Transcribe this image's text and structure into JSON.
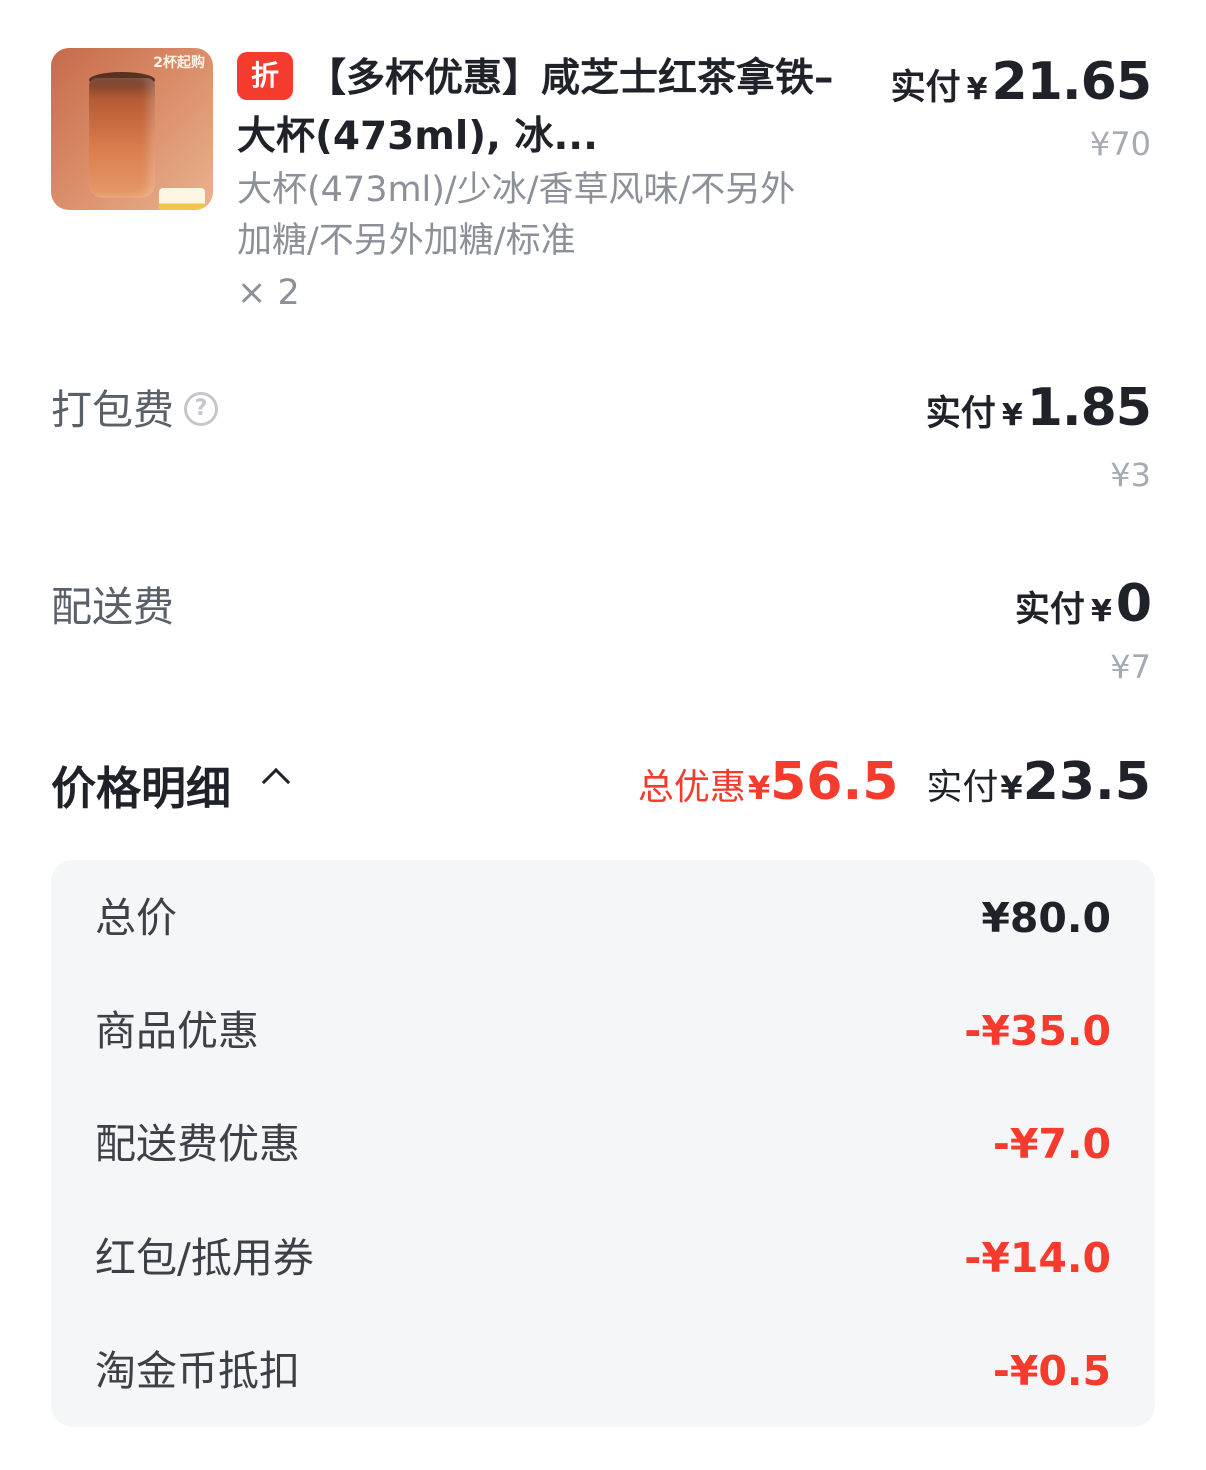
{
  "product": {
    "thumb_badge": "2杯起购",
    "discount_tag": "折",
    "title": "【多杯优惠】咸芝士红茶拿铁–大杯(473ml), 冰...",
    "specs": "大杯(473ml)/少冰/香草风味/不另外加糖/不另外加糖/标准",
    "quantity": "× 2",
    "pay_label": "实付",
    "pay_currency": "¥",
    "pay_amount": "21.65",
    "original_price": "¥70"
  },
  "packing_fee": {
    "label": "打包费",
    "help_icon": "?",
    "pay_label": "实付",
    "pay_currency": "¥",
    "pay_amount": "1.85",
    "original_price": "¥3"
  },
  "delivery_fee": {
    "label": "配送费",
    "pay_label": "实付",
    "pay_currency": "¥",
    "pay_amount": "0",
    "original_price": "¥7"
  },
  "price_detail": {
    "title": "价格明细",
    "total_discount_label": "总优惠",
    "total_discount_currency": "¥",
    "total_discount_amount": "56.5",
    "pay_label": "实付",
    "pay_currency": "¥",
    "pay_amount": "23.5",
    "rows": [
      {
        "label": "总价",
        "value": "¥80.0"
      },
      {
        "label": "商品优惠",
        "value": "-¥35.0"
      },
      {
        "label": "配送费优惠",
        "value": "-¥7.0"
      },
      {
        "label": "红包/抵用券",
        "value": "-¥14.0"
      },
      {
        "label": "淘金币抵扣",
        "value": "-¥0.5"
      }
    ]
  },
  "colors": {
    "accent_red": "#f53b2d",
    "text_primary": "#1f2329",
    "text_secondary": "#8c9199",
    "panel_bg": "#f5f6f8"
  }
}
